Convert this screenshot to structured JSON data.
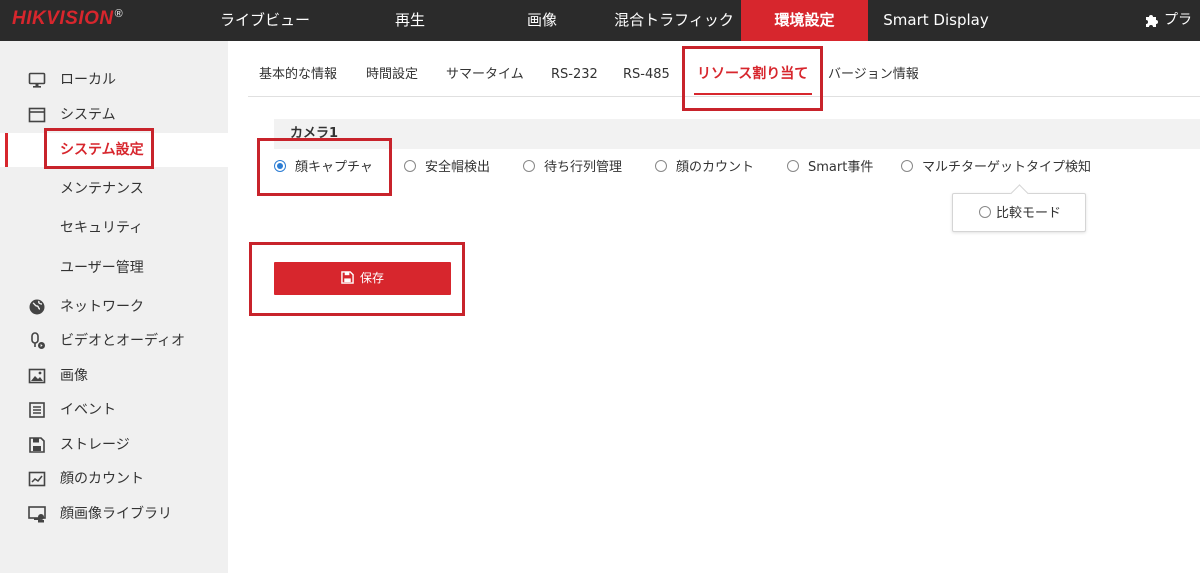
{
  "brand": {
    "logo": "HIKVISION",
    "registered": "®"
  },
  "topnav": {
    "items": [
      {
        "label": "ライブビュー"
      },
      {
        "label": "再生"
      },
      {
        "label": "画像"
      },
      {
        "label": "混合トラフィック"
      },
      {
        "label": "環境設定"
      },
      {
        "label": "Smart Display"
      }
    ],
    "active": "環境設定",
    "plugin_label": "プラ"
  },
  "sidebar": {
    "items": [
      {
        "label": "ローカル",
        "icon": "monitor-icon"
      },
      {
        "label": "システム",
        "icon": "window-icon"
      },
      {
        "label": "システム設定",
        "icon": ""
      },
      {
        "label": "メンテナンス",
        "icon": ""
      },
      {
        "label": "セキュリティ",
        "icon": ""
      },
      {
        "label": "ユーザー管理",
        "icon": ""
      },
      {
        "label": "ネットワーク",
        "icon": "globe-icon"
      },
      {
        "label": "ビデオとオーディオ",
        "icon": "microphone-icon"
      },
      {
        "label": "画像",
        "icon": "image-icon"
      },
      {
        "label": "イベント",
        "icon": "event-list-icon"
      },
      {
        "label": "ストレージ",
        "icon": "floppy-icon"
      },
      {
        "label": "顔のカウント",
        "icon": "chart-icon"
      },
      {
        "label": "顔画像ライブラリ",
        "icon": "face-library-icon"
      }
    ],
    "active": "システム設定"
  },
  "tabs": {
    "items": [
      {
        "label": "基本的な情報"
      },
      {
        "label": "時間設定"
      },
      {
        "label": "サマータイム"
      },
      {
        "label": "RS-232"
      },
      {
        "label": "RS-485"
      },
      {
        "label": "リソース割り当て"
      },
      {
        "label": "バージョン情報"
      }
    ],
    "active": "リソース割り当て"
  },
  "content": {
    "camera_label": "カメラ1",
    "options": [
      {
        "label": "顔キャプチャ",
        "checked": true
      },
      {
        "label": "安全帽検出",
        "checked": false
      },
      {
        "label": "待ち行列管理",
        "checked": false
      },
      {
        "label": "顔のカウント",
        "checked": false
      },
      {
        "label": "Smart事件",
        "checked": false
      },
      {
        "label": "マルチターゲットタイプ検知",
        "checked": false
      }
    ],
    "sub_option": {
      "label": "比較モード",
      "checked": false
    },
    "save_label": "保存"
  },
  "colors": {
    "accent": "#d7262d",
    "topbar": "#2b2b2b",
    "sidebar": "#f0f0f0",
    "radio_checked": "#2b7cd3"
  }
}
